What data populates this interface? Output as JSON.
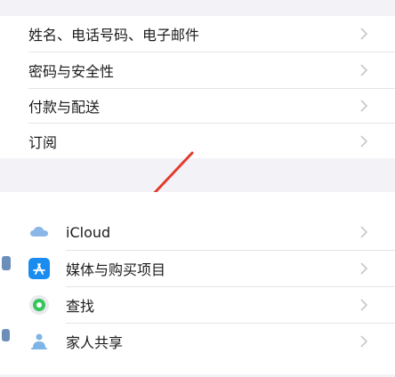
{
  "menu": {
    "items": [
      {
        "label": "姓名、电话号码、电子邮件"
      },
      {
        "label": "密码与安全性"
      },
      {
        "label": "付款与配送"
      },
      {
        "label": "订阅"
      }
    ]
  },
  "services": {
    "items": [
      {
        "label": "iCloud",
        "icon": "icloud-icon"
      },
      {
        "label": "媒体与购买项目",
        "icon": "app-store-icon"
      },
      {
        "label": "查找",
        "icon": "find-my-icon"
      },
      {
        "label": "家人共享",
        "icon": "family-sharing-icon"
      }
    ]
  },
  "annotation": {
    "arrow_color": "#e23b2e"
  },
  "colors": {
    "background": "#f2f2f7",
    "chevron": "#c7c7cc",
    "app_store": "#1a8cf0",
    "find_my": "#34c759"
  }
}
